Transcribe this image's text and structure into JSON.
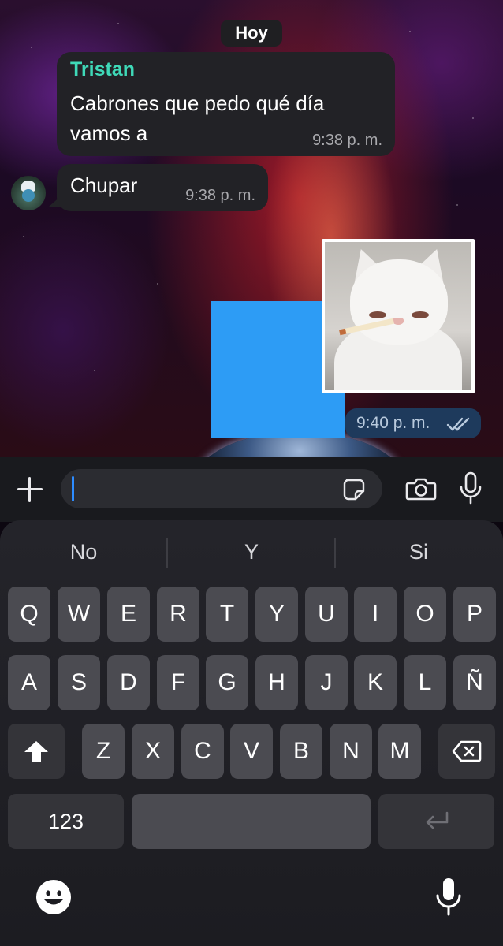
{
  "chat": {
    "date_label": "Hoy",
    "messages": [
      {
        "sender": "Tristan",
        "text": "Cabrones que pedo qué día vamos a",
        "time": "9:38 p. m.",
        "incoming": true
      },
      {
        "text": "Chupar",
        "time": "9:38 p. m.",
        "incoming": true
      },
      {
        "type": "image",
        "time": "9:40 p. m.",
        "incoming": false,
        "status": "read"
      }
    ]
  },
  "input": {
    "placeholder": "",
    "value": ""
  },
  "keyboard": {
    "suggestions": [
      "No",
      "Y",
      "Si"
    ],
    "row1": [
      "Q",
      "W",
      "E",
      "R",
      "T",
      "Y",
      "U",
      "I",
      "O",
      "P"
    ],
    "row2": [
      "A",
      "S",
      "D",
      "F",
      "G",
      "H",
      "J",
      "K",
      "L",
      "Ñ"
    ],
    "row3": [
      "Z",
      "X",
      "C",
      "V",
      "B",
      "N",
      "M"
    ],
    "numbers_key": "123"
  },
  "colors": {
    "accent_sender": "#3fd9b8",
    "outgoing_bubble": "#1e3a5c",
    "caret": "#2d8cff"
  }
}
